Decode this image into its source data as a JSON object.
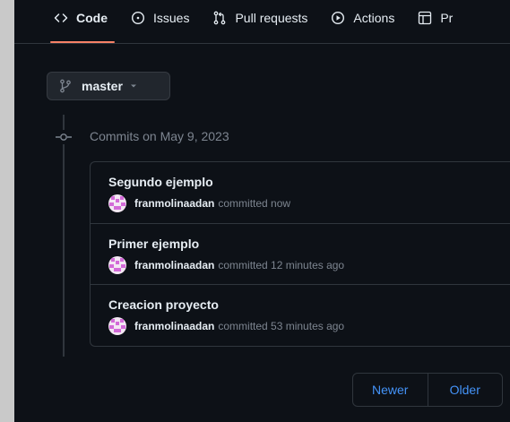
{
  "nav": {
    "tabs": [
      {
        "label": "Code",
        "icon": "code-icon",
        "active": true
      },
      {
        "label": "Issues",
        "icon": "issue-icon",
        "active": false
      },
      {
        "label": "Pull requests",
        "icon": "pull-request-icon",
        "active": false
      },
      {
        "label": "Actions",
        "icon": "play-icon",
        "active": false
      },
      {
        "label": "Pr",
        "icon": "table-icon",
        "active": false
      }
    ]
  },
  "branch": {
    "label": "master",
    "icon": "git-branch-icon"
  },
  "commits": {
    "heading": "Commits on May 9, 2023",
    "items": [
      {
        "title": "Segundo ejemplo",
        "author": "franmolinaadan",
        "meta": "committed now"
      },
      {
        "title": "Primer ejemplo",
        "author": "franmolinaadan",
        "meta": "committed 12 minutes ago"
      },
      {
        "title": "Creacion proyecto",
        "author": "franmolinaadan",
        "meta": "committed 53 minutes ago"
      }
    ]
  },
  "pagination": {
    "newer": "Newer",
    "older": "Older"
  },
  "colors": {
    "background": "#0d1117",
    "border": "#30363d",
    "active_tab_underline": "#f78166",
    "link": "#4493f8",
    "muted": "#7d8590"
  }
}
